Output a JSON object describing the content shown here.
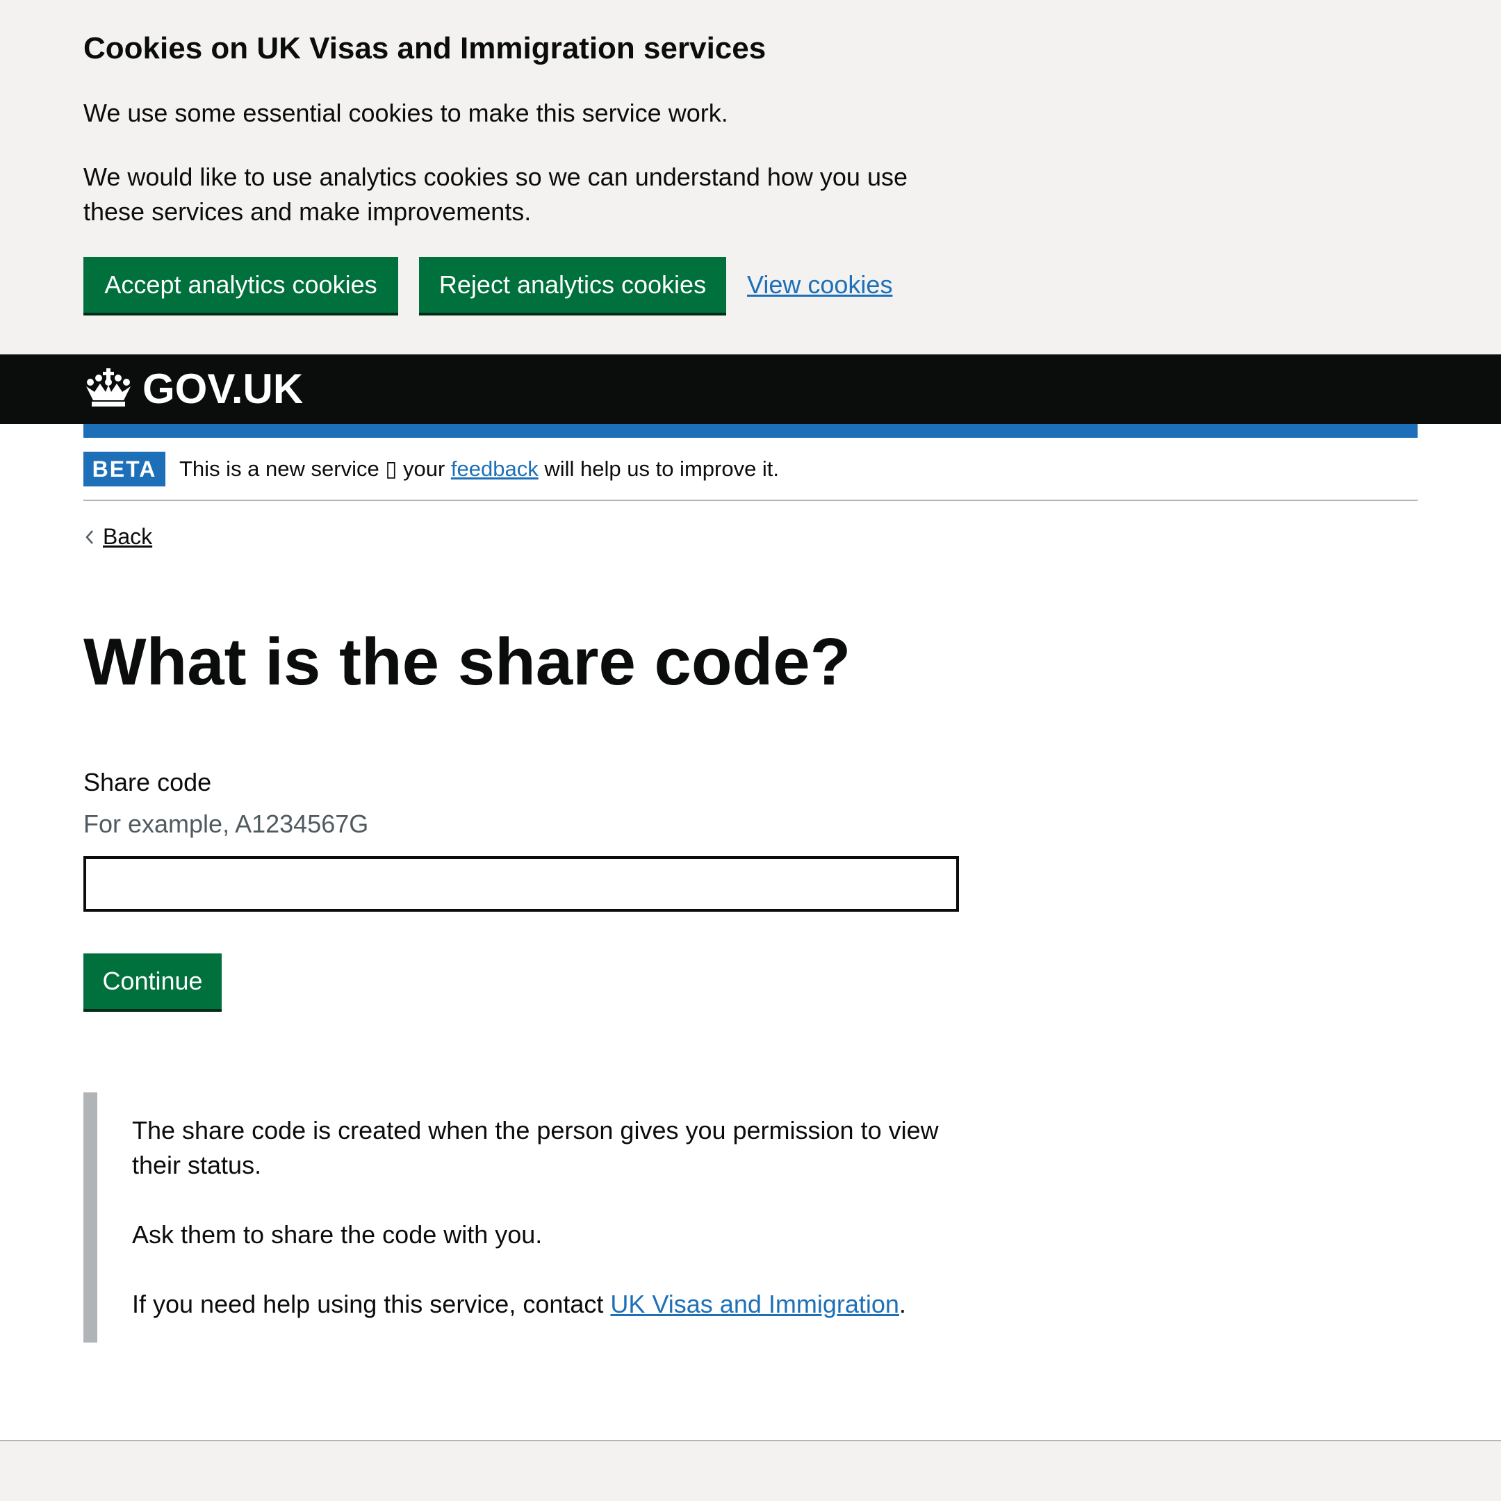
{
  "cookie_banner": {
    "title": "Cookies on UK Visas and Immigration services",
    "paragraph_1": "We use some essential cookies to make this service work.",
    "paragraph_2": "We would like to use analytics cookies so we can understand how you use these services and make improvements.",
    "accept_label": "Accept analytics cookies",
    "reject_label": "Reject analytics cookies",
    "view_label": "View cookies"
  },
  "header": {
    "logo_text": "GOV.UK",
    "logo_icon": "crown-icon"
  },
  "phase_banner": {
    "tag": "BETA",
    "text_before": "This is a new service ▯ your ",
    "link": "feedback",
    "text_after": " will help us to improve it."
  },
  "back_link": {
    "label": "Back",
    "icon": "chevron-left-icon"
  },
  "main": {
    "title": "What is the share code?",
    "field_label": "Share code",
    "field_hint": "For example, A1234567G",
    "field_value": "",
    "continue_label": "Continue"
  },
  "inset": {
    "paragraph_1": "The share code is created when the person gives you permission to view their status.",
    "paragraph_2": "Ask them to share the code with you.",
    "paragraph_3_before": "If you need help using this service, contact ",
    "paragraph_3_link": "UK Visas and Immigration",
    "paragraph_3_after": "."
  },
  "colors": {
    "button_green": "#00703c",
    "link_blue": "#1d70b8",
    "header_black": "#0b0c0c",
    "banner_grey": "#f3f2f1",
    "hint_grey": "#505a5f"
  }
}
